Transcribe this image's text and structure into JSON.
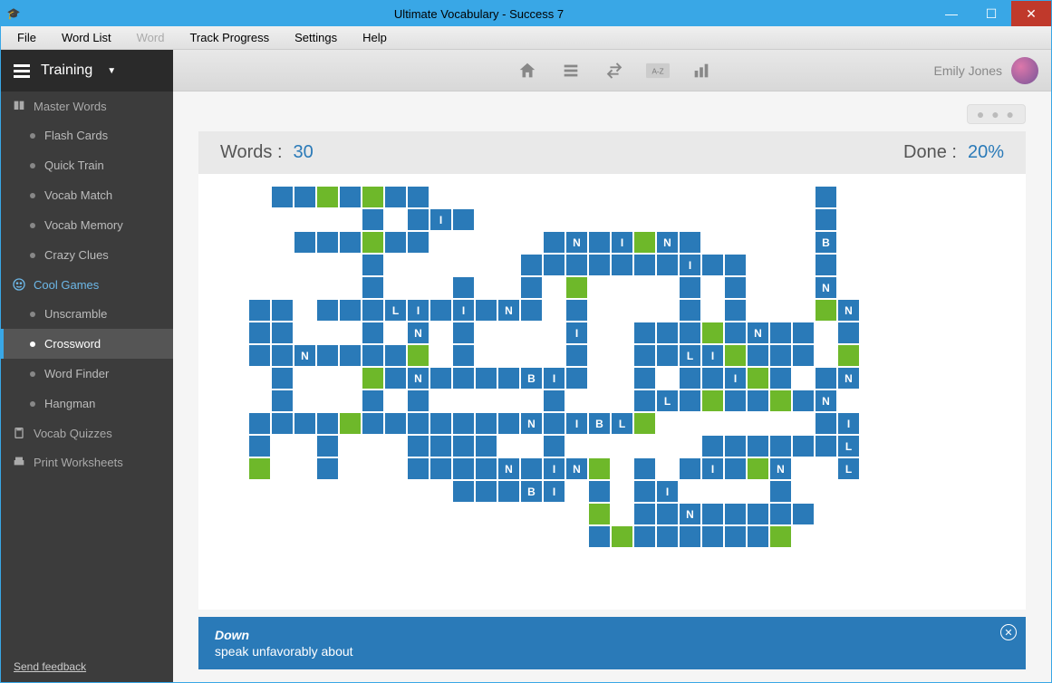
{
  "window_title": "Ultimate Vocabulary - Success 7",
  "menubar": [
    "File",
    "Word List",
    "Word",
    "Track Progress",
    "Settings",
    "Help"
  ],
  "menubar_disabled_index": 2,
  "sidebar": {
    "header_label": "Training",
    "groups": [
      {
        "title": "Master Words",
        "icon": "book",
        "active": false,
        "items": [
          "Flash Cards",
          "Quick Train",
          "Vocab Match",
          "Vocab Memory",
          "Crazy Clues"
        ]
      },
      {
        "title": "Cool Games",
        "icon": "smile",
        "active": true,
        "items": [
          "Unscramble",
          "Crossword",
          "Word Finder",
          "Hangman"
        ],
        "active_item": 1
      },
      {
        "title": "Vocab Quizzes",
        "icon": "clipboard",
        "active": false,
        "items": []
      },
      {
        "title": "Print Worksheets",
        "icon": "printer",
        "active": false,
        "items": []
      }
    ],
    "feedback": "Send feedback"
  },
  "toolbar_icons": [
    "home",
    "list",
    "swap",
    "az",
    "chart"
  ],
  "user_name": "Emily Jones",
  "stats": {
    "words_label": "Words  :",
    "words_value": "30",
    "done_label": "Done  :",
    "done_value": "20%"
  },
  "clue": {
    "direction": "Down",
    "text": "speak unfavorably about"
  },
  "cells": [
    {
      "r": 1,
      "c": 2
    },
    {
      "r": 1,
      "c": 3
    },
    {
      "r": 1,
      "c": 4,
      "cls": "g"
    },
    {
      "r": 1,
      "c": 5
    },
    {
      "r": 1,
      "c": 6,
      "cls": "g"
    },
    {
      "r": 1,
      "c": 7
    },
    {
      "r": 1,
      "c": 8
    },
    {
      "r": 1,
      "c": 26
    },
    {
      "r": 2,
      "c": 6
    },
    {
      "r": 2,
      "c": 8
    },
    {
      "r": 2,
      "c": 9,
      "t": "I"
    },
    {
      "r": 2,
      "c": 10
    },
    {
      "r": 2,
      "c": 26
    },
    {
      "r": 3,
      "c": 3
    },
    {
      "r": 3,
      "c": 4
    },
    {
      "r": 3,
      "c": 5
    },
    {
      "r": 3,
      "c": 6,
      "cls": "g"
    },
    {
      "r": 3,
      "c": 7
    },
    {
      "r": 3,
      "c": 8
    },
    {
      "r": 3,
      "c": 14
    },
    {
      "r": 3,
      "c": 15,
      "t": "N"
    },
    {
      "r": 3,
      "c": 16
    },
    {
      "r": 3,
      "c": 17,
      "t": "I"
    },
    {
      "r": 3,
      "c": 18,
      "cls": "g"
    },
    {
      "r": 3,
      "c": 19,
      "t": "N"
    },
    {
      "r": 3,
      "c": 20
    },
    {
      "r": 3,
      "c": 26,
      "t": "B"
    },
    {
      "r": 4,
      "c": 6
    },
    {
      "r": 4,
      "c": 13
    },
    {
      "r": 4,
      "c": 14
    },
    {
      "r": 4,
      "c": 15
    },
    {
      "r": 4,
      "c": 16
    },
    {
      "r": 4,
      "c": 17
    },
    {
      "r": 4,
      "c": 18
    },
    {
      "r": 4,
      "c": 19
    },
    {
      "r": 4,
      "c": 20,
      "t": "I"
    },
    {
      "r": 4,
      "c": 21
    },
    {
      "r": 4,
      "c": 22
    },
    {
      "r": 4,
      "c": 26
    },
    {
      "r": 5,
      "c": 6
    },
    {
      "r": 5,
      "c": 10
    },
    {
      "r": 5,
      "c": 13
    },
    {
      "r": 5,
      "c": 15,
      "cls": "g"
    },
    {
      "r": 5,
      "c": 20
    },
    {
      "r": 5,
      "c": 22
    },
    {
      "r": 5,
      "c": 26,
      "t": "N"
    },
    {
      "r": 6,
      "c": 1
    },
    {
      "r": 6,
      "c": 2
    },
    {
      "r": 6,
      "c": 4
    },
    {
      "r": 6,
      "c": 5
    },
    {
      "r": 6,
      "c": 6
    },
    {
      "r": 6,
      "c": 7,
      "t": "L"
    },
    {
      "r": 6,
      "c": 8,
      "t": "I"
    },
    {
      "r": 6,
      "c": 9
    },
    {
      "r": 6,
      "c": 10,
      "t": "I"
    },
    {
      "r": 6,
      "c": 11
    },
    {
      "r": 6,
      "c": 12,
      "t": "N"
    },
    {
      "r": 6,
      "c": 13
    },
    {
      "r": 6,
      "c": 15
    },
    {
      "r": 6,
      "c": 20
    },
    {
      "r": 6,
      "c": 22
    },
    {
      "r": 6,
      "c": 26,
      "cls": "g"
    },
    {
      "r": 6,
      "c": 27,
      "t": "N"
    },
    {
      "r": 7,
      "c": 1
    },
    {
      "r": 7,
      "c": 2
    },
    {
      "r": 7,
      "c": 6
    },
    {
      "r": 7,
      "c": 8,
      "t": "N"
    },
    {
      "r": 7,
      "c": 10
    },
    {
      "r": 7,
      "c": 15,
      "t": "I"
    },
    {
      "r": 7,
      "c": 18
    },
    {
      "r": 7,
      "c": 19
    },
    {
      "r": 7,
      "c": 20
    },
    {
      "r": 7,
      "c": 21,
      "cls": "g"
    },
    {
      "r": 7,
      "c": 22
    },
    {
      "r": 7,
      "c": 23,
      "t": "N"
    },
    {
      "r": 7,
      "c": 24
    },
    {
      "r": 7,
      "c": 25
    },
    {
      "r": 7,
      "c": 27
    },
    {
      "r": 8,
      "c": 1
    },
    {
      "r": 8,
      "c": 2
    },
    {
      "r": 8,
      "c": 3,
      "t": "N"
    },
    {
      "r": 8,
      "c": 4
    },
    {
      "r": 8,
      "c": 5
    },
    {
      "r": 8,
      "c": 6
    },
    {
      "r": 8,
      "c": 7
    },
    {
      "r": 8,
      "c": 8,
      "cls": "g"
    },
    {
      "r": 8,
      "c": 10
    },
    {
      "r": 8,
      "c": 15
    },
    {
      "r": 8,
      "c": 18
    },
    {
      "r": 8,
      "c": 19
    },
    {
      "r": 8,
      "c": 20,
      "t": "L"
    },
    {
      "r": 8,
      "c": 21,
      "t": "I"
    },
    {
      "r": 8,
      "c": 22,
      "cls": "g"
    },
    {
      "r": 8,
      "c": 23
    },
    {
      "r": 8,
      "c": 24
    },
    {
      "r": 8,
      "c": 25
    },
    {
      "r": 8,
      "c": 27,
      "cls": "g"
    },
    {
      "r": 9,
      "c": 2
    },
    {
      "r": 9,
      "c": 6,
      "cls": "g"
    },
    {
      "r": 9,
      "c": 7
    },
    {
      "r": 9,
      "c": 8,
      "t": "N"
    },
    {
      "r": 9,
      "c": 9
    },
    {
      "r": 9,
      "c": 10
    },
    {
      "r": 9,
      "c": 11
    },
    {
      "r": 9,
      "c": 12
    },
    {
      "r": 9,
      "c": 13,
      "t": "B"
    },
    {
      "r": 9,
      "c": 14,
      "t": "I"
    },
    {
      "r": 9,
      "c": 15
    },
    {
      "r": 9,
      "c": 18
    },
    {
      "r": 9,
      "c": 20
    },
    {
      "r": 9,
      "c": 21
    },
    {
      "r": 9,
      "c": 22,
      "t": "I"
    },
    {
      "r": 9,
      "c": 23,
      "cls": "g"
    },
    {
      "r": 9,
      "c": 24
    },
    {
      "r": 9,
      "c": 26
    },
    {
      "r": 9,
      "c": 27,
      "t": "N"
    },
    {
      "r": 10,
      "c": 2
    },
    {
      "r": 10,
      "c": 6
    },
    {
      "r": 10,
      "c": 8
    },
    {
      "r": 10,
      "c": 14
    },
    {
      "r": 10,
      "c": 18
    },
    {
      "r": 10,
      "c": 19,
      "t": "L"
    },
    {
      "r": 10,
      "c": 20
    },
    {
      "r": 10,
      "c": 21,
      "cls": "g"
    },
    {
      "r": 10,
      "c": 22
    },
    {
      "r": 10,
      "c": 23
    },
    {
      "r": 10,
      "c": 24,
      "cls": "g"
    },
    {
      "r": 10,
      "c": 25
    },
    {
      "r": 10,
      "c": 26,
      "t": "N"
    },
    {
      "r": 11,
      "c": 1
    },
    {
      "r": 11,
      "c": 2
    },
    {
      "r": 11,
      "c": 3
    },
    {
      "r": 11,
      "c": 4
    },
    {
      "r": 11,
      "c": 5,
      "cls": "g"
    },
    {
      "r": 11,
      "c": 6
    },
    {
      "r": 11,
      "c": 7
    },
    {
      "r": 11,
      "c": 8
    },
    {
      "r": 11,
      "c": 9
    },
    {
      "r": 11,
      "c": 10
    },
    {
      "r": 11,
      "c": 11
    },
    {
      "r": 11,
      "c": 12
    },
    {
      "r": 11,
      "c": 13,
      "t": "N"
    },
    {
      "r": 11,
      "c": 14
    },
    {
      "r": 11,
      "c": 15,
      "t": "I"
    },
    {
      "r": 11,
      "c": 16,
      "t": "B"
    },
    {
      "r": 11,
      "c": 17,
      "t": "L"
    },
    {
      "r": 11,
      "c": 18,
      "cls": "g"
    },
    {
      "r": 11,
      "c": 26
    },
    {
      "r": 11,
      "c": 27,
      "t": "I"
    },
    {
      "r": 12,
      "c": 1
    },
    {
      "r": 12,
      "c": 4
    },
    {
      "r": 12,
      "c": 8
    },
    {
      "r": 12,
      "c": 9
    },
    {
      "r": 12,
      "c": 10
    },
    {
      "r": 12,
      "c": 11
    },
    {
      "r": 12,
      "c": 14
    },
    {
      "r": 12,
      "c": 21
    },
    {
      "r": 12,
      "c": 22
    },
    {
      "r": 12,
      "c": 23
    },
    {
      "r": 12,
      "c": 24
    },
    {
      "r": 12,
      "c": 25
    },
    {
      "r": 12,
      "c": 26
    },
    {
      "r": 12,
      "c": 27,
      "t": "L"
    },
    {
      "r": 13,
      "c": 1,
      "cls": "g"
    },
    {
      "r": 13,
      "c": 4
    },
    {
      "r": 13,
      "c": 8
    },
    {
      "r": 13,
      "c": 9
    },
    {
      "r": 13,
      "c": 10
    },
    {
      "r": 13,
      "c": 11
    },
    {
      "r": 13,
      "c": 12,
      "t": "N"
    },
    {
      "r": 13,
      "c": 13
    },
    {
      "r": 13,
      "c": 14,
      "t": "I"
    },
    {
      "r": 13,
      "c": 15,
      "t": "N"
    },
    {
      "r": 13,
      "c": 16,
      "cls": "g"
    },
    {
      "r": 13,
      "c": 18
    },
    {
      "r": 13,
      "c": 20
    },
    {
      "r": 13,
      "c": 21,
      "t": "I"
    },
    {
      "r": 13,
      "c": 22
    },
    {
      "r": 13,
      "c": 23,
      "cls": "g"
    },
    {
      "r": 13,
      "c": 24,
      "t": "N"
    },
    {
      "r": 13,
      "c": 27,
      "t": "L"
    },
    {
      "r": 14,
      "c": 10
    },
    {
      "r": 14,
      "c": 11
    },
    {
      "r": 14,
      "c": 12
    },
    {
      "r": 14,
      "c": 13,
      "t": "B"
    },
    {
      "r": 14,
      "c": 14,
      "t": "I"
    },
    {
      "r": 14,
      "c": 16
    },
    {
      "r": 14,
      "c": 18
    },
    {
      "r": 14,
      "c": 19,
      "t": "I"
    },
    {
      "r": 14,
      "c": 24
    },
    {
      "r": 15,
      "c": 16,
      "cls": "g"
    },
    {
      "r": 15,
      "c": 18
    },
    {
      "r": 15,
      "c": 19
    },
    {
      "r": 15,
      "c": 20,
      "t": "N"
    },
    {
      "r": 15,
      "c": 21
    },
    {
      "r": 15,
      "c": 22
    },
    {
      "r": 15,
      "c": 23
    },
    {
      "r": 15,
      "c": 24
    },
    {
      "r": 15,
      "c": 25
    },
    {
      "r": 16,
      "c": 16
    },
    {
      "r": 16,
      "c": 17,
      "cls": "g"
    },
    {
      "r": 16,
      "c": 18
    },
    {
      "r": 16,
      "c": 19
    },
    {
      "r": 16,
      "c": 20
    },
    {
      "r": 16,
      "c": 21
    },
    {
      "r": 16,
      "c": 22
    },
    {
      "r": 16,
      "c": 23
    },
    {
      "r": 16,
      "c": 24,
      "cls": "g"
    }
  ]
}
